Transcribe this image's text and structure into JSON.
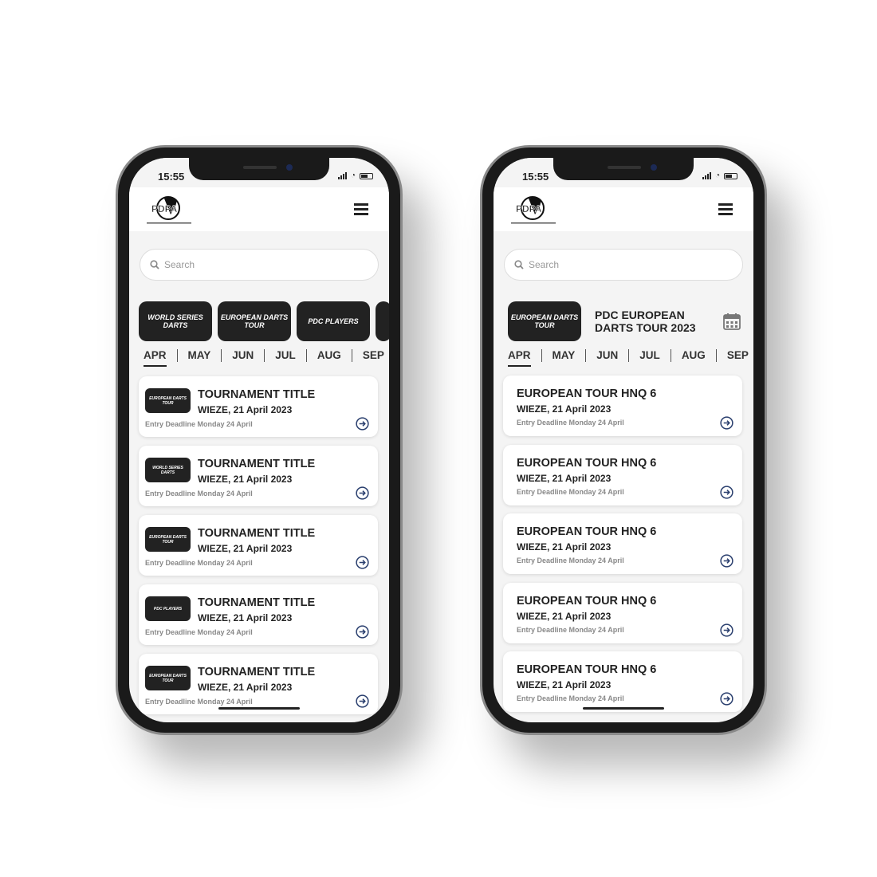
{
  "status": {
    "time": "15:55"
  },
  "brand": {
    "logo_text": "PDPA"
  },
  "search": {
    "placeholder": "Search"
  },
  "categories": [
    {
      "label": "WORLD SERIES DARTS"
    },
    {
      "label": "EUROPEAN DARTS TOUR"
    },
    {
      "label": "PDC PLAYERS"
    }
  ],
  "months": [
    "APR",
    "MAY",
    "JUN",
    "JUL",
    "AUG",
    "SEP"
  ],
  "left": {
    "cards": [
      {
        "logo": "EUROPEAN DARTS TOUR",
        "title": "TOURNAMENT TITLE",
        "sub": "WIEZE, 21 April 2023",
        "deadline": "Entry Deadline Monday 24 April"
      },
      {
        "logo": "WORLD SERIES DARTS",
        "title": "TOURNAMENT TITLE",
        "sub": "WIEZE, 21 April 2023",
        "deadline": "Entry Deadline Monday 24 April"
      },
      {
        "logo": "EUROPEAN DARTS TOUR",
        "title": "TOURNAMENT TITLE",
        "sub": "WIEZE, 21 April 2023",
        "deadline": "Entry Deadline Monday 24 April"
      },
      {
        "logo": "PDC PLAYERS",
        "title": "TOURNAMENT TITLE",
        "sub": "WIEZE, 21 April 2023",
        "deadline": "Entry Deadline Monday 24 April"
      },
      {
        "logo": "EUROPEAN DARTS TOUR",
        "title": "TOURNAMENT TITLE",
        "sub": "WIEZE, 21 April 2023",
        "deadline": "Entry Deadline Monday 24 April"
      }
    ]
  },
  "right": {
    "featured": {
      "logo": "EUROPEAN DARTS TOUR",
      "title": "PDC EUROPEAN DARTS TOUR 2023"
    },
    "cards": [
      {
        "title": "EUROPEAN TOUR HNQ 6",
        "sub": "WIEZE, 21 April 2023",
        "deadline": "Entry Deadline Monday 24 April"
      },
      {
        "title": "EUROPEAN TOUR HNQ 6",
        "sub": "WIEZE, 21 April 2023",
        "deadline": "Entry Deadline Monday 24 April"
      },
      {
        "title": "EUROPEAN TOUR HNQ 6",
        "sub": "WIEZE, 21 April 2023",
        "deadline": "Entry Deadline Monday 24 April"
      },
      {
        "title": "EUROPEAN TOUR HNQ 6",
        "sub": "WIEZE, 21 April 2023",
        "deadline": "Entry Deadline Monday 24 April"
      },
      {
        "title": "EUROPEAN TOUR HNQ 6",
        "sub": "WIEZE, 21 April 2023",
        "deadline": "Entry Deadline Monday 24 April"
      }
    ]
  },
  "colors": {
    "accent": "#2a3f6e",
    "dark": "#222222",
    "background": "#f4f4f4"
  }
}
